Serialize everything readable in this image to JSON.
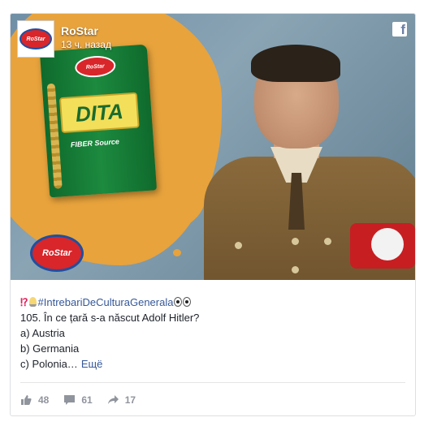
{
  "post": {
    "page_name": "RoStar",
    "timestamp": "13 ч. назад",
    "avatar_logo_text": "RoStar",
    "platform_icon": "facebook-icon",
    "image": {
      "package_brand": "RoStar",
      "package_title": "DITA",
      "package_subtitle": "FIBER Source",
      "corner_logo": "RoStar"
    },
    "text": {
      "hashtag": "#IntrebariDeCulturaGenerala",
      "question": "105. În ce țară s-a născut Adolf Hitler?",
      "option_a": "a) Austria",
      "option_b": "b) Germania",
      "option_c": "c) Polonia…",
      "see_more": "Ещё"
    },
    "stats": {
      "likes": "48",
      "comments": "61",
      "shares": "17"
    }
  },
  "colors": {
    "link": "#365899",
    "text": "#1d2129",
    "brand_red": "#d8262b",
    "brand_blue": "#1f4fa0",
    "orange_splash": "#e8a33c"
  }
}
